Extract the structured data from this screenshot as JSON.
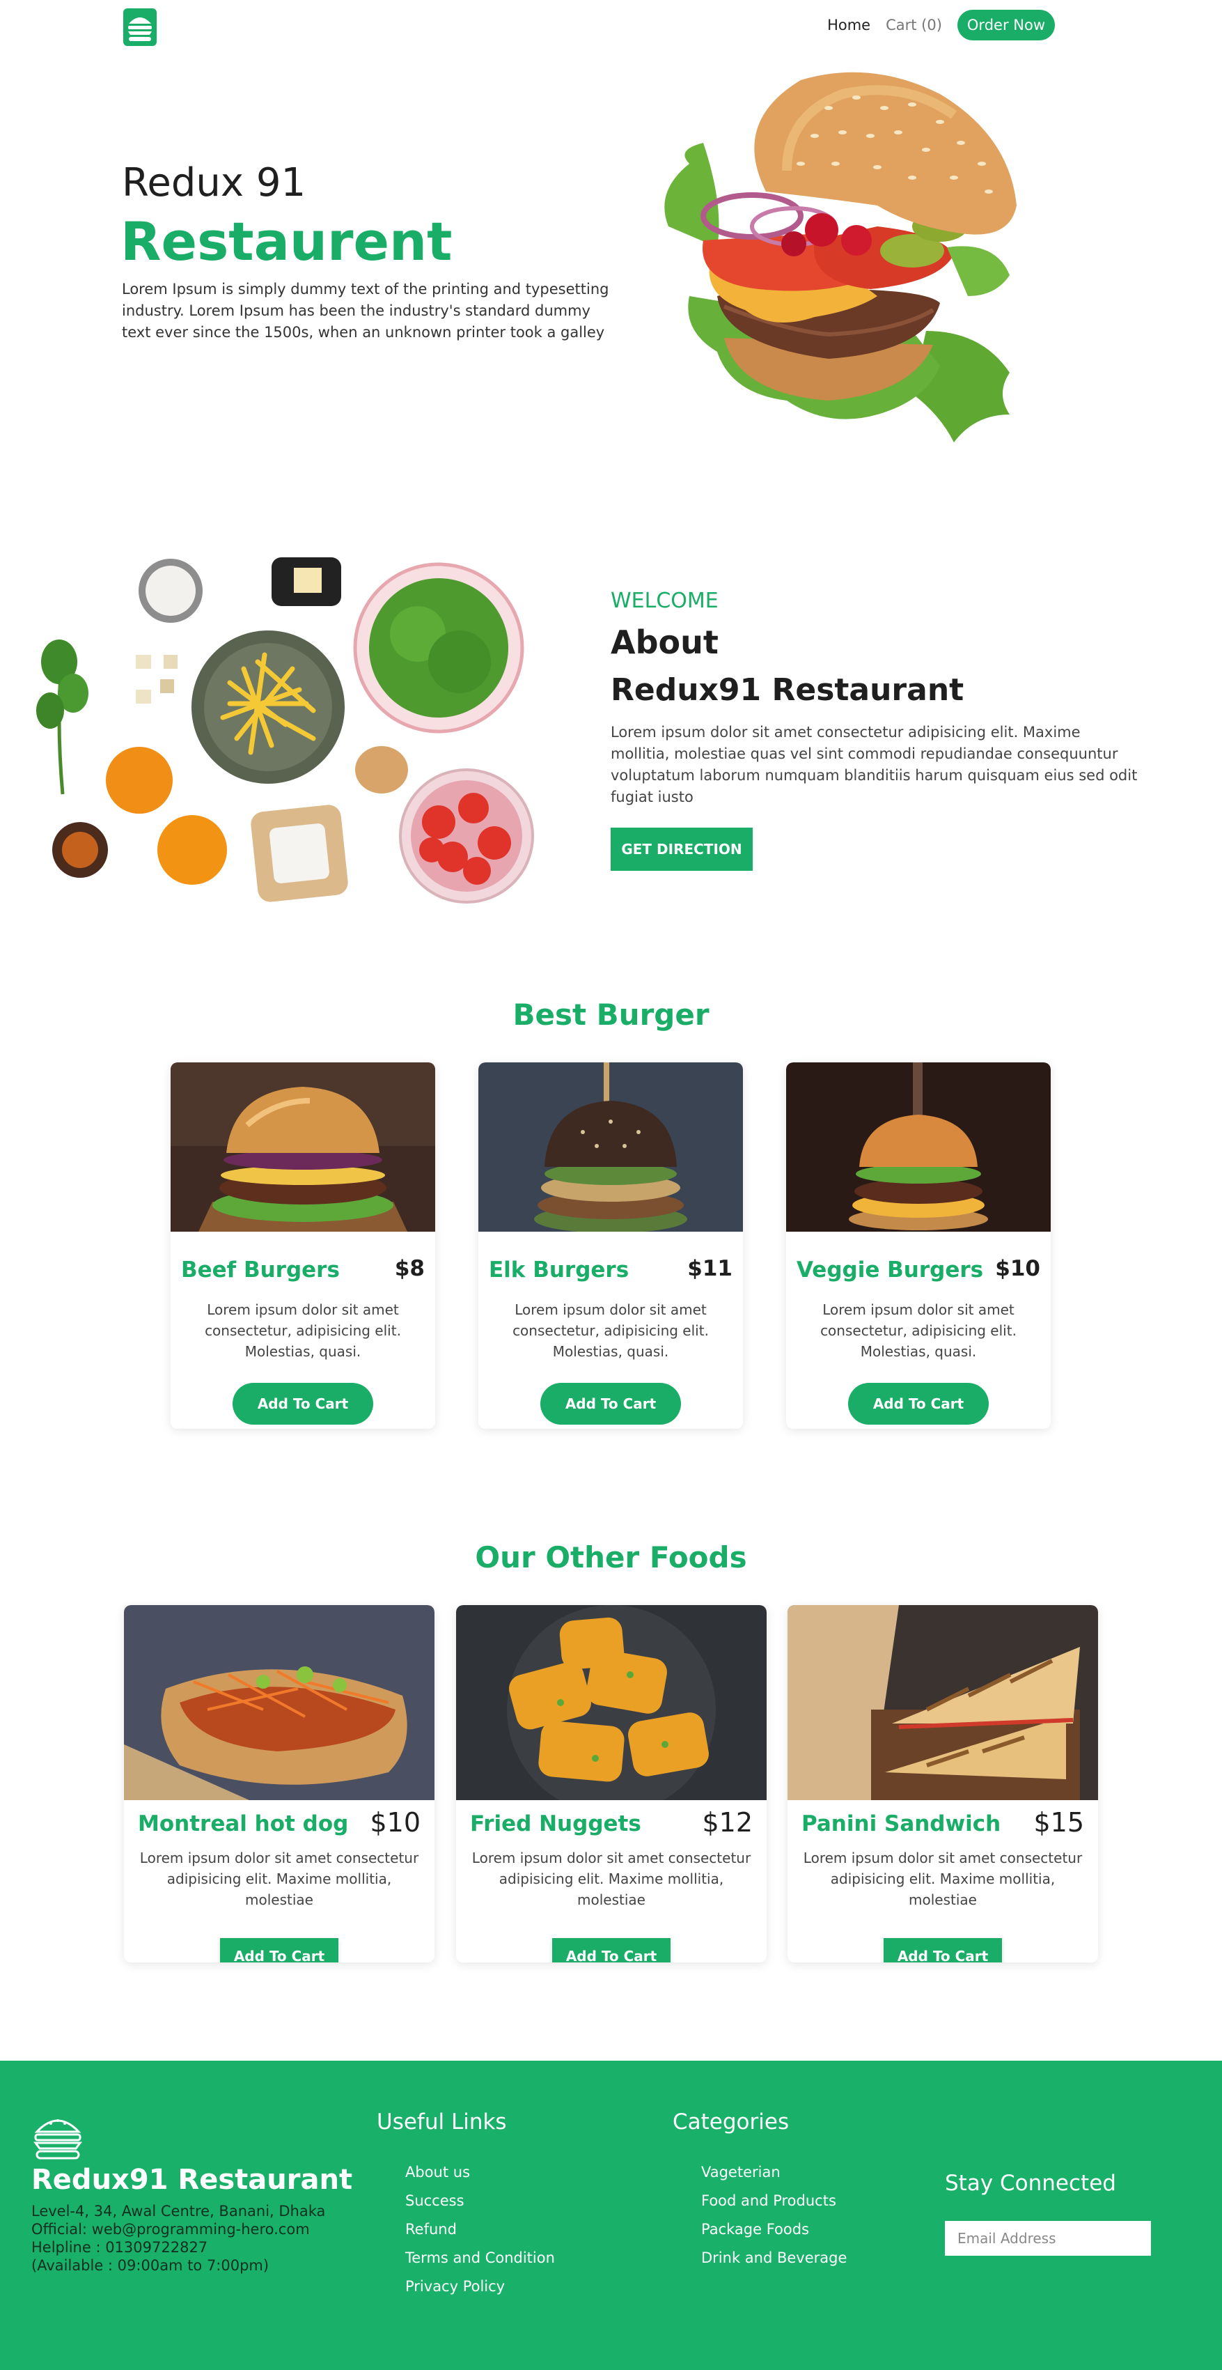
{
  "nav": {
    "logo_icon": "burger-logo-icon",
    "home_label": "Home",
    "cart_label": "Cart (0)",
    "order_label": "Order Now"
  },
  "hero": {
    "subtitle": "Redux 91",
    "title": "Restaurent",
    "text": "Lorem Ipsum is simply dummy text of the printing and typesetting industry. Lorem Ipsum has been the industry's standard dummy text ever since the 1500s, when an unknown printer took a galley",
    "image_icon": "burger-illustration"
  },
  "about": {
    "image_icon": "ingredients-illustration",
    "welcome": "WELCOME",
    "title_line1": "About",
    "title_line2": "Redux91 Restaurant",
    "text": "Lorem ipsum dolor sit amet consectetur adipisicing elit. Maxime mollitia, molestiae quas vel sint commodi repudiandae consequuntur voluptatum laborum numquam blanditiis harum quisquam eius sed odit fugiat iusto",
    "button_label": "GET DIRECTION"
  },
  "best_burger": {
    "title": "Best Burger",
    "items": [
      {
        "name": "Beef Burgers",
        "price": "$8",
        "desc": "Lorem ipsum dolor sit amet consectetur, adipisicing elit. Molestias, quasi.",
        "button": "Add To Cart"
      },
      {
        "name": "Elk Burgers",
        "price": "$11",
        "desc": "Lorem ipsum dolor sit amet consectetur, adipisicing elit. Molestias, quasi.",
        "button": "Add To Cart"
      },
      {
        "name": "Veggie Burgers",
        "price": "$10",
        "desc": "Lorem ipsum dolor sit amet consectetur, adipisicing elit. Molestias, quasi.",
        "button": "Add To Cart"
      }
    ]
  },
  "other_foods": {
    "title": "Our Other Foods",
    "items": [
      {
        "name": "Montreal hot dog",
        "price": "$10",
        "desc": "Lorem ipsum dolor sit amet consectetur adipisicing elit. Maxime mollitia, molestiae",
        "button": "Add To Cart"
      },
      {
        "name": "Fried Nuggets",
        "price": "$12",
        "desc": "Lorem ipsum dolor sit amet consectetur adipisicing elit. Maxime mollitia, molestiae",
        "button": "Add To Cart"
      },
      {
        "name": "Panini Sandwich",
        "price": "$15",
        "desc": "Lorem ipsum dolor sit amet consectetur adipisicing elit. Maxime mollitia, molestiae",
        "button": "Add To Cart"
      }
    ]
  },
  "footer": {
    "logo_icon": "burger-logo-icon",
    "title": "Redux91 Restaurant",
    "address_lines": [
      "Level-4, 34, Awal Centre, Banani, Dhaka",
      "Official: web@programming-hero.com",
      "Helpline : 01309722827",
      "(Available : 09:00am to 7:00pm)"
    ],
    "useful_links_title": "Useful Links",
    "useful_links": [
      "About us",
      "Success",
      "Refund",
      "Terms and Condition",
      "Privacy Policy"
    ],
    "categories_title": "Categories",
    "categories": [
      "Vageterian",
      "Food and Products",
      "Package Foods",
      "Drink and Beverage"
    ],
    "stay_connected": "Stay Connected",
    "email_placeholder": "Email Address"
  },
  "colors": {
    "accent": "#19ad67",
    "footer_bg": "#19b069",
    "text_dark": "#1f1f1f"
  }
}
